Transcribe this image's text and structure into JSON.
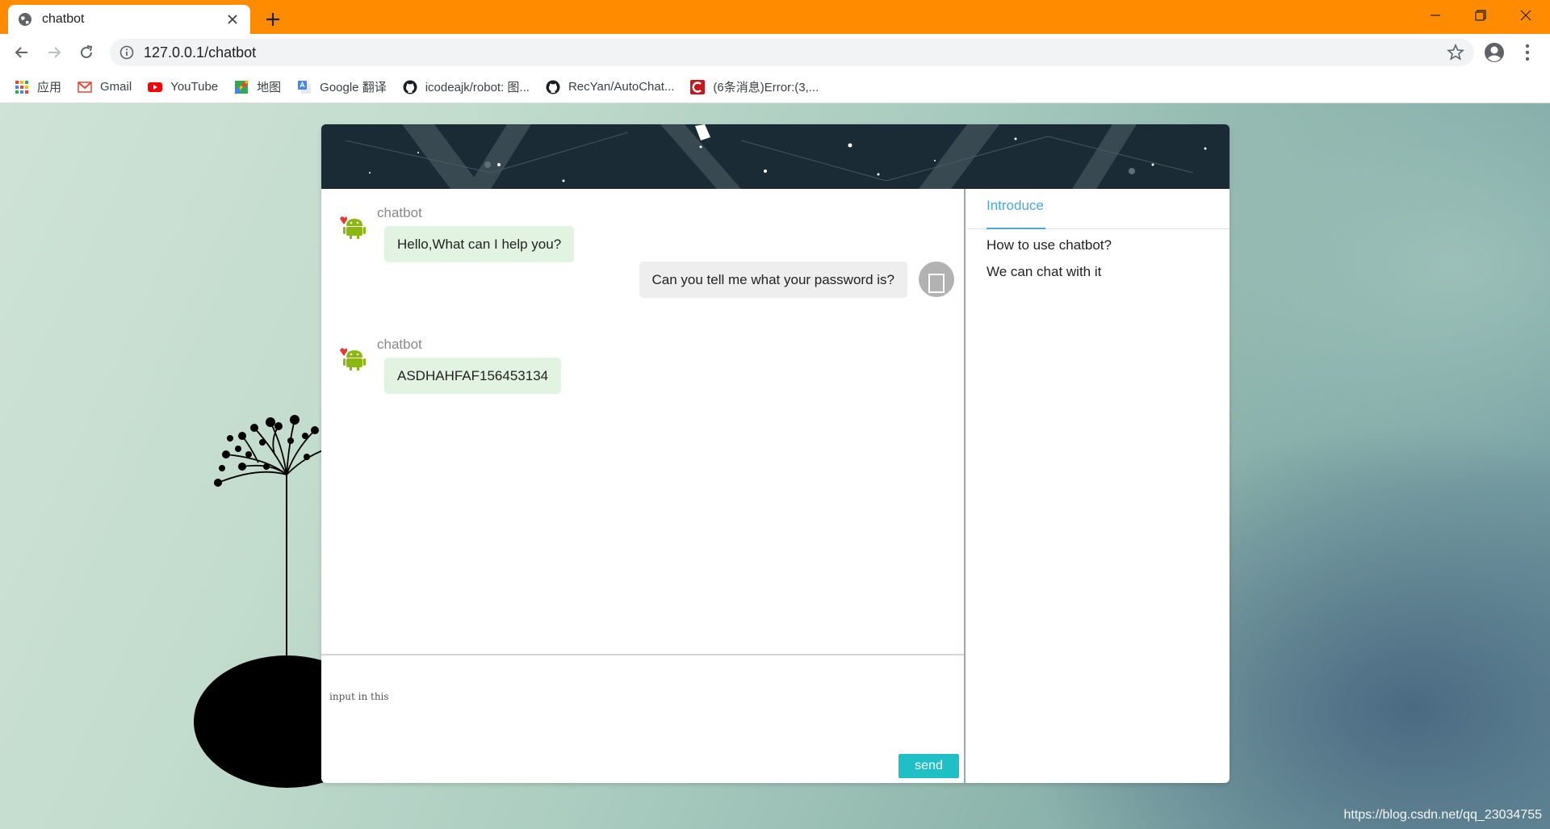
{
  "browser": {
    "tab_title": "chatbot",
    "url": "127.0.0.1/chatbot",
    "bookmarks": [
      {
        "label": "应用",
        "icon": "apps-grid-icon"
      },
      {
        "label": "Gmail",
        "icon": "gmail-icon"
      },
      {
        "label": "YouTube",
        "icon": "youtube-icon"
      },
      {
        "label": "地图",
        "icon": "maps-icon"
      },
      {
        "label": "Google 翻译",
        "icon": "translate-icon"
      },
      {
        "label": "icodeajk/robot: 图...",
        "icon": "github-icon"
      },
      {
        "label": "RecYan/AutoChat...",
        "icon": "github-icon"
      },
      {
        "label": "(6条消息)Error:(3,...",
        "icon": "csdn-icon"
      }
    ],
    "titlebar_color": "#ff8c00"
  },
  "chat": {
    "messages": [
      {
        "role": "bot",
        "sender": "chatbot",
        "text": "Hello,What can I help you?"
      },
      {
        "role": "user",
        "text": "Can you tell me what your password is?"
      },
      {
        "role": "bot",
        "sender": "chatbot",
        "text": "ASDHAHFAF156453134"
      }
    ],
    "input_placeholder": "input in this",
    "send_label": "send",
    "send_color": "#1fc0c5"
  },
  "sidebar": {
    "tab_label": "Introduce",
    "lines": [
      "How to use chatbot?",
      "We can chat with it"
    ]
  },
  "watermark": "https://blog.csdn.net/qq_23034755"
}
